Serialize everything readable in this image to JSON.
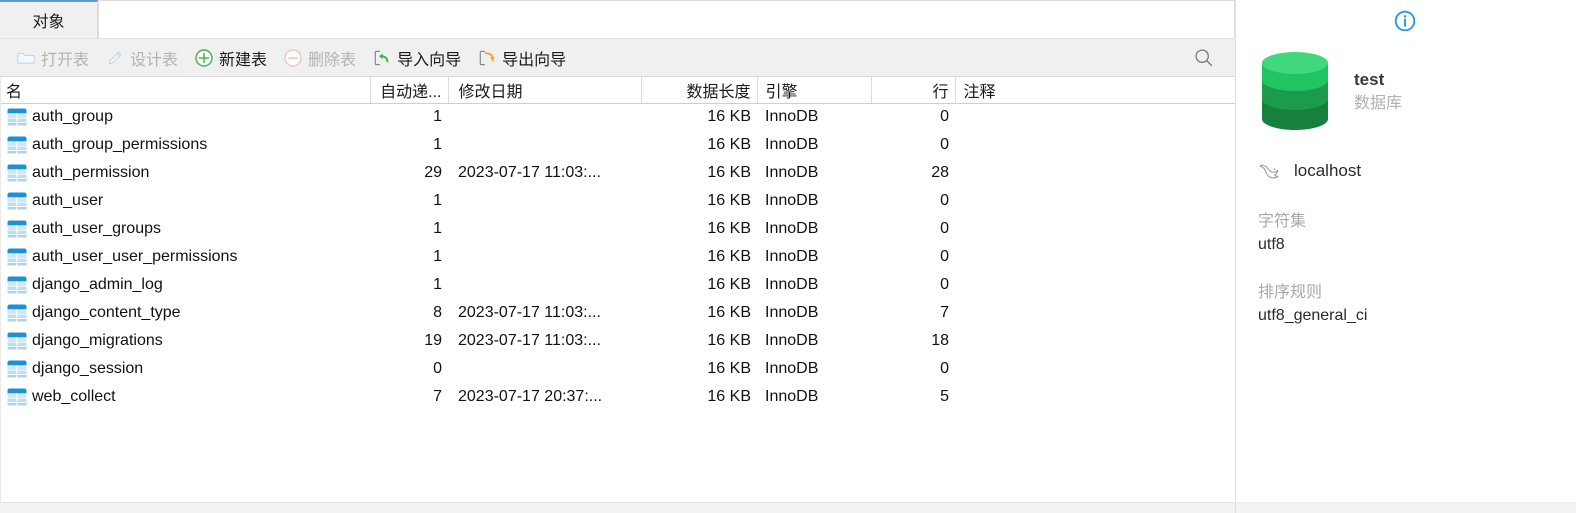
{
  "tabs": {
    "items": [
      {
        "label": "对象",
        "active": true
      }
    ]
  },
  "toolbar": {
    "items": [
      {
        "label": "打开表",
        "icon": "folder-icon",
        "enabled": false
      },
      {
        "label": "设计表",
        "icon": "pencil-icon",
        "enabled": false
      },
      {
        "label": "新建表",
        "icon": "plus-circle-icon",
        "enabled": true
      },
      {
        "label": "删除表",
        "icon": "minus-circle-icon",
        "enabled": false
      },
      {
        "label": "导入向导",
        "icon": "import-arrow-icon",
        "enabled": true
      },
      {
        "label": "导出向导",
        "icon": "export-arrow-icon",
        "enabled": true
      }
    ],
    "search_icon": "search-icon"
  },
  "grid": {
    "columns": [
      {
        "key": "name",
        "label": "名",
        "align": "left"
      },
      {
        "key": "auto",
        "label": "自动递...",
        "align": "right"
      },
      {
        "key": "date",
        "label": "修改日期",
        "align": "left"
      },
      {
        "key": "length",
        "label": "数据长度",
        "align": "right"
      },
      {
        "key": "engine",
        "label": "引擎",
        "align": "left"
      },
      {
        "key": "rows",
        "label": "行",
        "align": "right"
      },
      {
        "key": "comment",
        "label": "注释",
        "align": "left"
      }
    ],
    "rows": [
      {
        "name": "auth_group",
        "auto": "1",
        "date": "",
        "length": "16 KB",
        "engine": "InnoDB",
        "rows": "0",
        "comment": ""
      },
      {
        "name": "auth_group_permissions",
        "auto": "1",
        "date": "",
        "length": "16 KB",
        "engine": "InnoDB",
        "rows": "0",
        "comment": ""
      },
      {
        "name": "auth_permission",
        "auto": "29",
        "date": "2023-07-17 11:03:...",
        "length": "16 KB",
        "engine": "InnoDB",
        "rows": "28",
        "comment": ""
      },
      {
        "name": "auth_user",
        "auto": "1",
        "date": "",
        "length": "16 KB",
        "engine": "InnoDB",
        "rows": "0",
        "comment": ""
      },
      {
        "name": "auth_user_groups",
        "auto": "1",
        "date": "",
        "length": "16 KB",
        "engine": "InnoDB",
        "rows": "0",
        "comment": ""
      },
      {
        "name": "auth_user_user_permissions",
        "auto": "1",
        "date": "",
        "length": "16 KB",
        "engine": "InnoDB",
        "rows": "0",
        "comment": ""
      },
      {
        "name": "django_admin_log",
        "auto": "1",
        "date": "",
        "length": "16 KB",
        "engine": "InnoDB",
        "rows": "0",
        "comment": ""
      },
      {
        "name": "django_content_type",
        "auto": "8",
        "date": "2023-07-17 11:03:...",
        "length": "16 KB",
        "engine": "InnoDB",
        "rows": "7",
        "comment": ""
      },
      {
        "name": "django_migrations",
        "auto": "19",
        "date": "2023-07-17 11:03:...",
        "length": "16 KB",
        "engine": "InnoDB",
        "rows": "18",
        "comment": ""
      },
      {
        "name": "django_session",
        "auto": "0",
        "date": "",
        "length": "16 KB",
        "engine": "InnoDB",
        "rows": "0",
        "comment": ""
      },
      {
        "name": "web_collect",
        "auto": "7",
        "date": "2023-07-17 20:37:...",
        "length": "16 KB",
        "engine": "InnoDB",
        "rows": "5",
        "comment": ""
      }
    ],
    "row_icon": "table-icon"
  },
  "sidebar": {
    "info_icon": "info-circle-icon",
    "database": {
      "icon": "database-cylinder-icon",
      "name": "test",
      "kind": "数据库"
    },
    "host": {
      "icon": "mysql-dolphin-icon",
      "name": "localhost"
    },
    "fields": [
      {
        "label": "字符集",
        "value": "utf8"
      },
      {
        "label": "排序规则",
        "value": "utf8_general_ci"
      }
    ]
  },
  "colors": {
    "accent_blue": "#2196f3",
    "tab_accent": "#5a9bd5",
    "db_green": "#21b25b",
    "import_green": "#3cb54a",
    "export_orange": "#f5a623",
    "table_icon_blue": "#2196d6",
    "toolbar_bg": "#f0f0f0",
    "disabled_text": "#b3b3b3"
  }
}
